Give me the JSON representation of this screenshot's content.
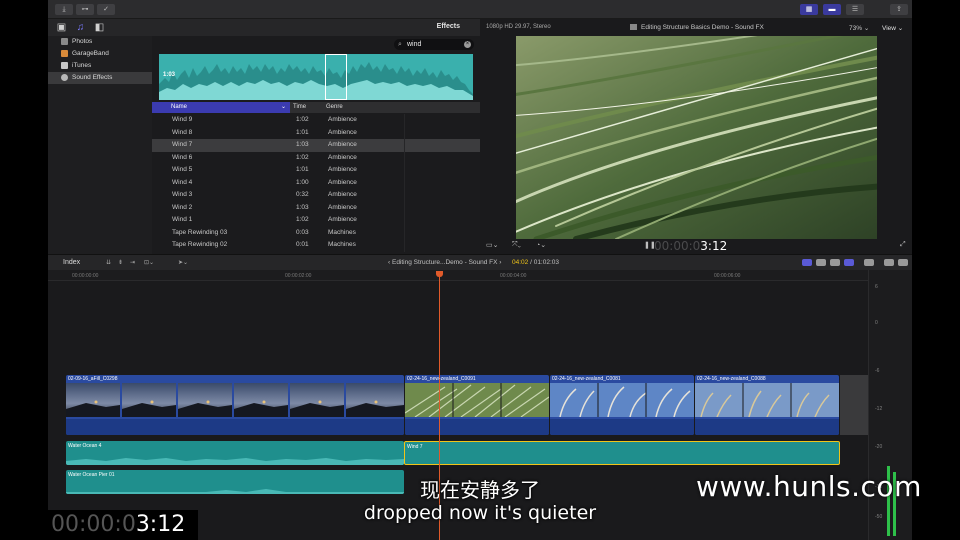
{
  "toolbar": {
    "import_icon": "download-arrow-icon",
    "keys_icon": "key-icon",
    "check_icon": "check-circle-icon",
    "share_icon": "share-icon"
  },
  "libraries": {
    "effects_label": "Effects",
    "sidebar": [
      {
        "label": "Photos",
        "icon": "photos-icon"
      },
      {
        "label": "GarageBand",
        "icon": "garageband-icon"
      },
      {
        "label": "iTunes",
        "icon": "itunes-icon"
      },
      {
        "label": "Sound Effects",
        "icon": "sound-effects-icon"
      }
    ]
  },
  "browser": {
    "search_value": "wind",
    "waveform_duration": "1:03",
    "columns": {
      "name": "Name",
      "time": "Time",
      "genre": "Genre"
    },
    "rows": [
      {
        "name": "Wind 9",
        "time": "1:02",
        "genre": "Ambience"
      },
      {
        "name": "Wind 8",
        "time": "1:01",
        "genre": "Ambience"
      },
      {
        "name": "Wind 7",
        "time": "1:03",
        "genre": "Ambience"
      },
      {
        "name": "Wind 6",
        "time": "1:02",
        "genre": "Ambience"
      },
      {
        "name": "Wind 5",
        "time": "1:01",
        "genre": "Ambience"
      },
      {
        "name": "Wind 4",
        "time": "1:00",
        "genre": "Ambience"
      },
      {
        "name": "Wind 3",
        "time": "0:32",
        "genre": "Ambience"
      },
      {
        "name": "Wind 2",
        "time": "1:03",
        "genre": "Ambience"
      },
      {
        "name": "Wind 1",
        "time": "1:02",
        "genre": "Ambience"
      },
      {
        "name": "Tape Rewinding 03",
        "time": "0:03",
        "genre": "Machines"
      },
      {
        "name": "Tape Rewinding 02",
        "time": "0:01",
        "genre": "Machines"
      }
    ],
    "selected_row": 2
  },
  "viewer": {
    "format": "1080p HD 29.97, Stereo",
    "title": "Editing Structure Basics Demo - Sound FX",
    "zoom": "73%",
    "view_label": "View",
    "timecode_dim": "00:00:0",
    "timecode_bright": "3:12"
  },
  "timeline": {
    "index_label": "Index",
    "project_title": "Editing Structure...Demo - Sound FX",
    "current_time": "04:02",
    "total_time": "01:02:03",
    "ruler_ticks": [
      "00:00:00:00",
      "00:00:02:00",
      "00:00:04:00",
      "00:00:06:00"
    ],
    "video_clips": [
      {
        "label": "02-09-16_aFill_C0298"
      },
      {
        "label": "02-24-16_new-zealand_C0091"
      },
      {
        "label": "02-24-16_new-zealand_C0081"
      },
      {
        "label": "02-24-16_new-zealand_C0088"
      }
    ],
    "audio_clips": [
      {
        "label": "Water Ocean 4"
      },
      {
        "label": "Wind 7"
      },
      {
        "label": "Water Ocean Pier 01"
      }
    ],
    "meter_labels": [
      "6",
      "0",
      "-6",
      "-12",
      "-20",
      "-30",
      "-50"
    ]
  },
  "overlay": {
    "timecode_dim": "00:00:0",
    "timecode_bright": "3:12",
    "subtitle_cn": "现在安静多了",
    "subtitle_en": "dropped now it's quieter",
    "watermark": "www.hunls.com"
  }
}
